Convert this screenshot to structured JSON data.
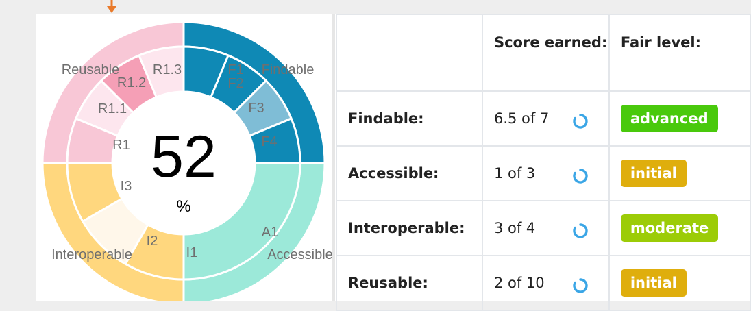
{
  "center": {
    "value": "52",
    "unit": "%"
  },
  "chart_labels": {
    "outer": [
      "Findable",
      "Accessible",
      "Interoperable",
      "Reusable"
    ],
    "inner": [
      "F1",
      "F2",
      "F3",
      "F4",
      "A1",
      "I1",
      "I2",
      "I3",
      "R1",
      "R1.1",
      "R1.2",
      "R1.3"
    ]
  },
  "colors": {
    "findable": "#0f89b5",
    "accessible": "#9ce9d9",
    "interoperable": "#ffd77e",
    "reusable": "#f8c7d6",
    "advanced": "#49c90c",
    "moderate": "#9ccc07",
    "initial": "#dfae0d",
    "spinner": "#3ba6e6",
    "arrow": "#e97a2b"
  },
  "table": {
    "headers": [
      "",
      "Score earned:",
      "Fair level:"
    ],
    "rows": [
      {
        "dimension": "Findable:",
        "score": "6.5 of 7",
        "level": "advanced"
      },
      {
        "dimension": "Accessible:",
        "score": "1 of 3",
        "level": "initial"
      },
      {
        "dimension": "Interoperable:",
        "score": "3 of 4",
        "level": "moderate"
      },
      {
        "dimension": "Reusable:",
        "score": "2 of 10",
        "level": "initial"
      }
    ]
  }
}
